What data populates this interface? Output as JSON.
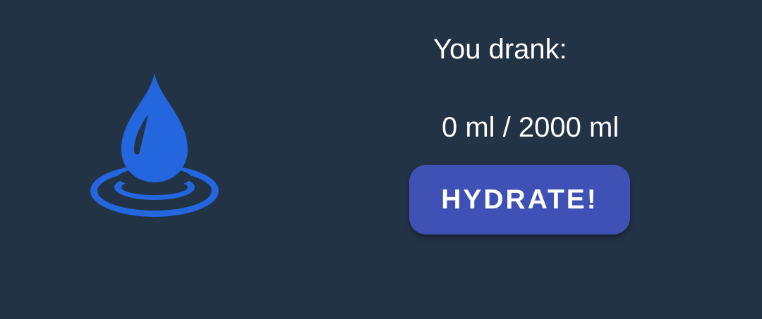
{
  "icons": {
    "drop": "water-drop-icon"
  },
  "colors": {
    "background": "#233346",
    "accent": "#2366de",
    "button": "#3f51b5",
    "text": "#ffffff"
  },
  "status": {
    "label": "You drank:",
    "amount": "0 ml / 2000 ml"
  },
  "actions": {
    "hydrate_label": "HYDRATE!"
  }
}
